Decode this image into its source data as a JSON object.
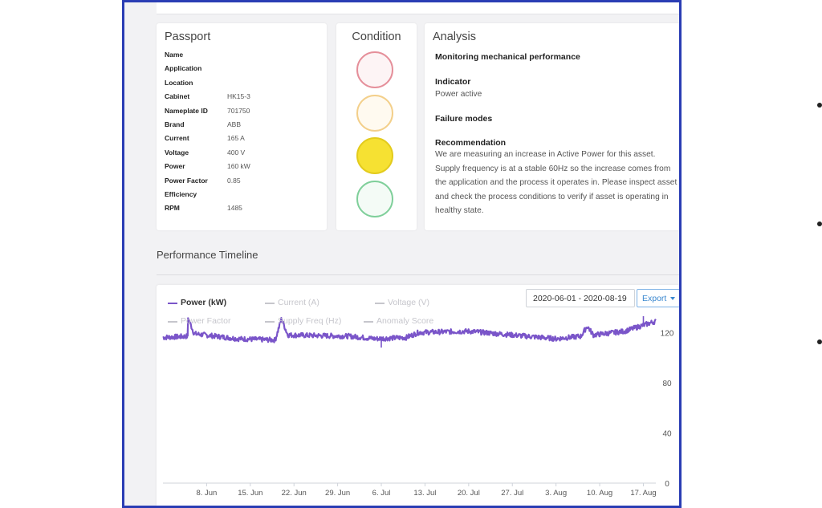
{
  "passport": {
    "title": "Passport",
    "rows": [
      {
        "label": "Name",
        "value": ""
      },
      {
        "label": "Application",
        "value": ""
      },
      {
        "label": "Location",
        "value": ""
      },
      {
        "label": "Cabinet",
        "value": "HK15-3"
      },
      {
        "label": "Nameplate ID",
        "value": "701750"
      },
      {
        "label": "Brand",
        "value": "ABB"
      },
      {
        "label": "Current",
        "value": "165 A"
      },
      {
        "label": "Voltage",
        "value": "400 V"
      },
      {
        "label": "Power",
        "value": "160 kW"
      },
      {
        "label": "Power Factor",
        "value": "0.85"
      },
      {
        "label": "Efficiency",
        "value": ""
      },
      {
        "label": "RPM",
        "value": "1485"
      }
    ]
  },
  "condition": {
    "title": "Condition",
    "lights": [
      {
        "name": "red",
        "active": false,
        "fill": "#fdf4f5",
        "border": "#e58f9a"
      },
      {
        "name": "amber",
        "active": false,
        "fill": "#fffaf0",
        "border": "#f3cf8a"
      },
      {
        "name": "yellow",
        "active": true,
        "fill": "#f6e132",
        "border": "#e3cb1c"
      },
      {
        "name": "green",
        "active": false,
        "fill": "#f4fbf6",
        "border": "#7fcf9a"
      }
    ]
  },
  "analysis": {
    "title": "Analysis",
    "headline": "Monitoring mechanical performance",
    "indicator_label": "Indicator",
    "indicator_value": "Power active",
    "failure_modes_label": "Failure modes",
    "recommendation_label": "Recommendation",
    "recommendation_text": "We are measuring an increase in Active Power for this asset. Supply frequency is at a stable 60Hz so the increase comes from the application and the process it operates in. Please inspect asset and check the process conditions to verify if asset is operating in healthy state."
  },
  "timeline": {
    "title": "Performance Timeline",
    "date_range": "2020-06-01 - 2020-08-19",
    "export_label": "Export",
    "legend": [
      {
        "name": "Power (kW)",
        "active": true
      },
      {
        "name": "Current (A)",
        "active": false
      },
      {
        "name": "Voltage (V)",
        "active": false
      },
      {
        "name": "Power Factor",
        "active": false
      },
      {
        "name": "Supply Freq (Hz)",
        "active": false
      },
      {
        "name": "Anomaly Score",
        "active": false
      }
    ]
  },
  "colors": {
    "accent": "#7a55c9",
    "inactive_legend": "#c6c6cc",
    "border": "#2a3db4"
  },
  "chart_data": {
    "type": "line",
    "series": [
      {
        "name": "Power (kW)",
        "color": "#7a55c9"
      }
    ],
    "x_range": [
      "2020-06-01",
      "2020-08-19"
    ],
    "x_ticks": [
      "8. Jun",
      "15. Jun",
      "22. Jun",
      "29. Jun",
      "6. Jul",
      "13. Jul",
      "20. Jul",
      "27. Jul",
      "3. Aug",
      "10. Aug",
      "17. Aug"
    ],
    "y_ticks": [
      0,
      40,
      80,
      120
    ],
    "ylim": [
      0,
      140
    ],
    "profile": [
      {
        "x": "2020-06-01",
        "y": 116
      },
      {
        "x": "2020-06-05",
        "y": 117
      },
      {
        "x": "2020-06-05",
        "y": 132
      },
      {
        "x": "2020-06-06",
        "y": 119
      },
      {
        "x": "2020-06-13",
        "y": 115
      },
      {
        "x": "2020-06-19",
        "y": 114
      },
      {
        "x": "2020-06-20",
        "y": 131
      },
      {
        "x": "2020-06-21",
        "y": 118
      },
      {
        "x": "2020-07-01",
        "y": 117
      },
      {
        "x": "2020-07-05",
        "y": 115
      },
      {
        "x": "2020-07-10",
        "y": 116
      },
      {
        "x": "2020-07-12",
        "y": 120
      },
      {
        "x": "2020-07-20",
        "y": 121
      },
      {
        "x": "2020-07-27",
        "y": 118
      },
      {
        "x": "2020-08-03",
        "y": 115
      },
      {
        "x": "2020-08-07",
        "y": 117
      },
      {
        "x": "2020-08-08",
        "y": 125
      },
      {
        "x": "2020-08-09",
        "y": 118
      },
      {
        "x": "2020-08-14",
        "y": 121
      },
      {
        "x": "2020-08-19",
        "y": 129
      }
    ]
  }
}
